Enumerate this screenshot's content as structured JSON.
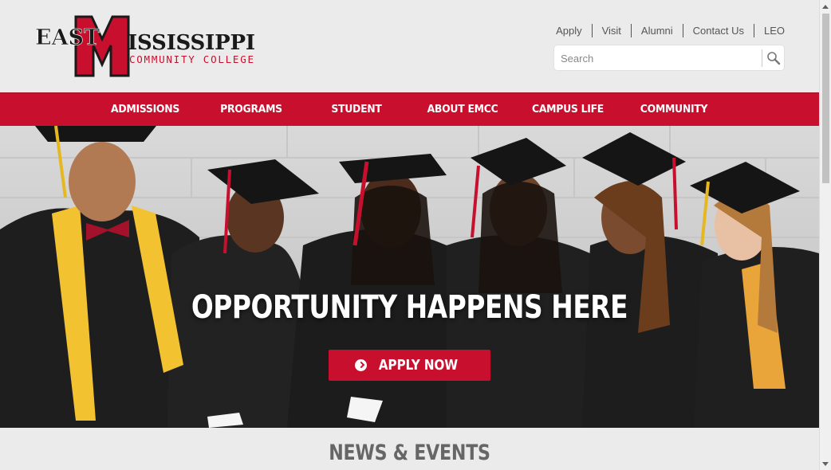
{
  "logo": {
    "line1": "EAST",
    "big_letter": "M",
    "line2": "ISSISSIPPI",
    "line3": "COMMUNITY COLLEGE",
    "colors": {
      "red": "#c8102e",
      "black": "#1a1a1a"
    }
  },
  "utility_nav": [
    "Apply",
    "Visit",
    "Alumni",
    "Contact Us",
    "LEO"
  ],
  "search": {
    "placeholder": "Search",
    "icon": "search-icon"
  },
  "main_nav": [
    "ADMISSIONS",
    "PROGRAMS",
    "STUDENT SERVICES",
    "ABOUT EMCC",
    "CAMPUS LIFE",
    "COMMUNITY"
  ],
  "hero": {
    "headline": "OPPORTUNITY HAPPENS HERE",
    "cta_label": "APPLY NOW",
    "cta_icon": "arrow-circle-right-icon"
  },
  "news": {
    "heading": "NEWS & EVENTS"
  },
  "colors": {
    "brand_red": "#c8102e",
    "background": "#ebebeb",
    "heading_gray": "#666666"
  }
}
